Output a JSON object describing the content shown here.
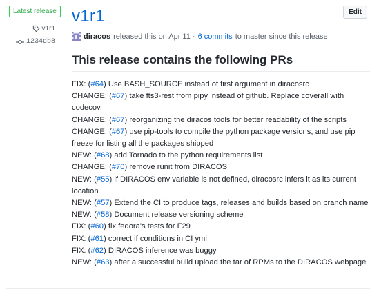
{
  "sidebar": {
    "badge": "Latest release",
    "tag": "v1r1",
    "commit": "1234db8"
  },
  "release": {
    "title": "v1r1",
    "edit_label": "Edit",
    "author": "diracos",
    "released_text": "released this on Apr 11 ·",
    "commits_link": "6 commits",
    "commits_suffix": "to master since this release",
    "heading": "This release contains the following PRs"
  },
  "changes": [
    {
      "prefix": "FIX: (",
      "pr": "#64",
      "text": ") Use BASH_SOURCE instead of first argument in diracosrc"
    },
    {
      "prefix": "CHANGE: (",
      "pr": "#67",
      "text": ") take fts3-rest from pipy instead of github. Replace coverall with codecov."
    },
    {
      "prefix": "CHANGE: (",
      "pr": "#67",
      "text": ") reorganizing the diracos tools for better readability of the scripts"
    },
    {
      "prefix": "CHANGE: (",
      "pr": "#67",
      "text": ") use pip-tools to compile the python package versions, and use pip freeze for listing all the packages shipped"
    },
    {
      "prefix": "NEW: (",
      "pr": "#68",
      "text": ") add Tornado to the python requirements list"
    },
    {
      "prefix": "CHANGE: (",
      "pr": "#70",
      "text": ") remove runit from DIRACOS"
    },
    {
      "prefix": "NEW: (",
      "pr": "#55",
      "text": ") if DIRACOS env variable is not defined, diracosrc infers it as its current location"
    },
    {
      "prefix": "NEW: (",
      "pr": "#57",
      "text": ") Extend the CI to produce tags, releases and builds based on branch name"
    },
    {
      "prefix": "NEW: (",
      "pr": "#58",
      "text": ") Document release versioning scheme"
    },
    {
      "prefix": "FIX: (",
      "pr": "#60",
      "text": ") fix fedora's tests for F29"
    },
    {
      "prefix": "FIX: (",
      "pr": "#61",
      "text": ") correct if conditions in CI yml"
    },
    {
      "prefix": "FIX: (",
      "pr": "#62",
      "text": ") DIRACOS inference was buggy"
    },
    {
      "prefix": "NEW: (",
      "pr": "#63",
      "text": ") after a successful build upload the tar of RPMs to the DIRACOS webpage"
    }
  ],
  "colors": {
    "link": "#0366d6",
    "badge_green": "#28a745",
    "text": "#24292e",
    "muted": "#586069"
  }
}
